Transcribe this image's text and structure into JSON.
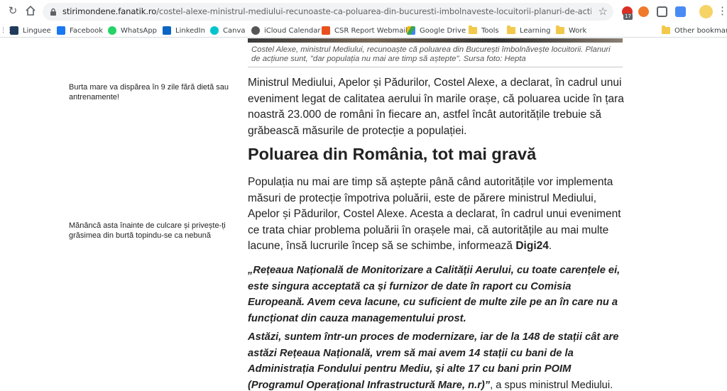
{
  "browser": {
    "url_host": "stirimondene.fanatik.ro",
    "url_path": "/costel-alexe-ministrul-mediului-recunoaste-ca-poluarea-din-bucuresti-imbolnaveste-locuitorii-planuri-de-actiune-sunt-dar-p...",
    "extension_badge": "17",
    "bookmarks": [
      {
        "label": "Linguee",
        "icon": "linguee-icon",
        "color": "#1f3a5c"
      },
      {
        "label": "Facebook",
        "icon": "facebook-icon",
        "color": "#1877f2"
      },
      {
        "label": "WhatsApp",
        "icon": "whatsapp-icon",
        "color": "#25d366"
      },
      {
        "label": "LinkedIn",
        "icon": "linkedin-icon",
        "color": "#0a66c2"
      },
      {
        "label": "Canva",
        "icon": "canva-icon",
        "color": "#00c4cc"
      },
      {
        "label": "iCloud Calendar",
        "icon": "apple-icon",
        "color": "#555555"
      },
      {
        "label": "CSR Report Webmail",
        "icon": "webmail-icon",
        "color": "#e8501e"
      },
      {
        "label": "Google Drive",
        "icon": "google-drive-icon",
        "color": "#34a853"
      },
      {
        "label": "Tools",
        "icon": "folder-icon",
        "color": "#f2c94c"
      },
      {
        "label": "Learning",
        "icon": "folder-icon",
        "color": "#f2c94c"
      },
      {
        "label": "Work",
        "icon": "folder-icon",
        "color": "#f2c94c"
      }
    ],
    "other_bookmarks": "Other bookmarks"
  },
  "caption": "Costel Alexe, ministrul Mediului, recunoaște că poluarea din București îmbolnăvește locuitorii. Planuri de acțiune sunt, \"dar populația nu mai are timp să aștepte\". Sursa foto: Hepta",
  "sidebar": {
    "link_1": "Burta mare va dispărea în 9 zile fără dietă sau antrenamente!",
    "link_2": "Mănâncă asta înainte de culcare și privește-ți grăsimea din burtă topindu-se ca nebună"
  },
  "article": {
    "paragraph_1": "Ministrul Mediului, Apelor și Pădurilor, Costel Alexe, a declarat, în cadrul unui eveniment legat de calitatea aerului în marile orașe, că poluarea ucide în țara noastră 23.000 de români în fiecare an, astfel încât autoritățile trebuie să grăbească măsurile de protecție a populației.",
    "heading": "Poluarea din România, tot mai gravă",
    "paragraph_2": "Populația nu mai are timp să aștepte până când autoritățile vor implementa măsuri de protecție împotriva poluării, este de părere ministrul Mediului, Apelor și Pădurilor, Costel Alexe. Acesta a declarat, în cadrul unui eveniment ce trata chiar problema poluării în orașele mai, că autoritățile au mai multe lacune, însă lucrurile încep să se schimbe, informează ",
    "paragraph_2_source": "Digi24",
    "paragraph_2_end": ".",
    "quote_1": "„Rețeaua Națională de Monitorizare a Calității Aerului, cu toate carențele ei, este singura acceptată ca și furnizor de date în raport cu Comisia Europeană. Avem ceva lacune, cu suficient de multe zile pe an în care nu a funcționat din cauza managementului prost.",
    "quote_2": "Astăzi, suntem într-un proces de modernizare, iar de la 148 de stații cât are astăzi Rețeaua Națională, vrem să mai avem 14 stații cu bani de la Administrația Fondului pentru Mediu, și alte 17 cu bani prin POIM (Programul Operațional Infrastructură Mare, n.r)”",
    "quote_2_tail": ", a spus ministrul Mediului."
  }
}
